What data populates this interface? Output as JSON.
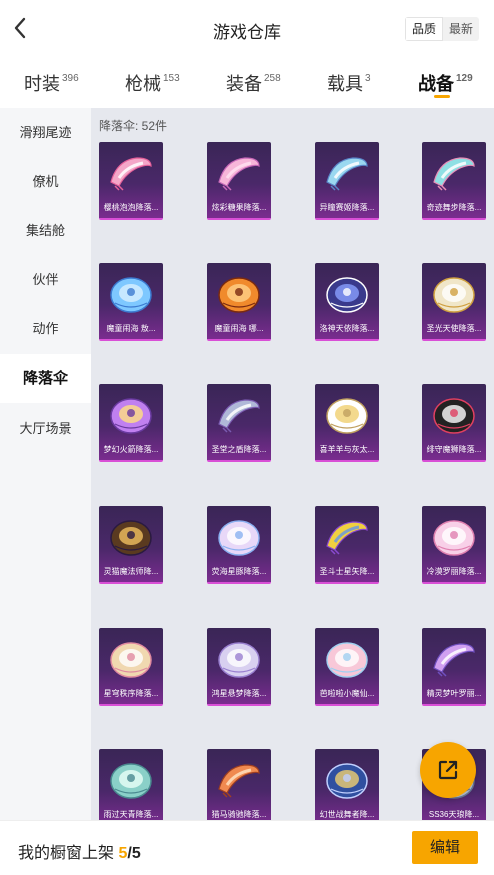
{
  "header": {
    "title": "游戏仓库",
    "sort_quality": "品质",
    "sort_newest": "最新"
  },
  "tabs": [
    {
      "label": "时装",
      "count": "396"
    },
    {
      "label": "枪械",
      "count": "153"
    },
    {
      "label": "装备",
      "count": "258"
    },
    {
      "label": "载具",
      "count": "3"
    },
    {
      "label": "战备",
      "count": "129",
      "active": true
    }
  ],
  "sidebar": {
    "items": [
      "滑翔尾迹",
      "僚机",
      "集结舱",
      "伙伴",
      "动作",
      "降落伞",
      "大厅场景"
    ],
    "active_index": 5
  },
  "content": {
    "count_label": "降落伞: 52件",
    "items": [
      {
        "label": "樱桃泡泡降落...",
        "icon": "pink-parachute"
      },
      {
        "label": "炫彩糖果降落...",
        "icon": "pink-parachute"
      },
      {
        "label": "异瞳赛姬降落...",
        "icon": "blue-parachute"
      },
      {
        "label": "奇迹舞步降落...",
        "icon": "teal-parachute"
      },
      {
        "label": "魔童闹海 敖...",
        "icon": "blue-round-parachute"
      },
      {
        "label": "魔童闹海 哪...",
        "icon": "fire-round-parachute"
      },
      {
        "label": "洛神天依降落...",
        "icon": "navy-round-parachute"
      },
      {
        "label": "圣光天使降落...",
        "icon": "white-gold-parachute"
      },
      {
        "label": "梦幻火箭降落...",
        "icon": "purple-parachute"
      },
      {
        "label": "圣堂之盾降落...",
        "icon": "silver-wing-parachute"
      },
      {
        "label": "喜羊羊与灰太...",
        "icon": "sheep-parachute"
      },
      {
        "label": "绯守魔狮降落...",
        "icon": "black-red-parachute"
      },
      {
        "label": "灵猫魔法师降...",
        "icon": "dark-gold-parachute"
      },
      {
        "label": "荧海星豚降落...",
        "icon": "pastel-parachute"
      },
      {
        "label": "圣斗士星矢降...",
        "icon": "gold-wing-parachute"
      },
      {
        "label": "冷漠罗丽降落...",
        "icon": "pink-white-parachute"
      },
      {
        "label": "星穹秩序降落...",
        "icon": "cream-parachute"
      },
      {
        "label": "鸿星悬梦降落...",
        "icon": "lilac-parachute"
      },
      {
        "label": "芭啦啦小魔仙...",
        "icon": "pink-fairy-parachute"
      },
      {
        "label": "精灵梦叶罗丽...",
        "icon": "purple-wing-parachute"
      },
      {
        "label": "雨过天青降落...",
        "icon": "teal-round-parachute"
      },
      {
        "label": "猎马骑驰降落...",
        "icon": "orange-wing-parachute"
      },
      {
        "label": "幻世战舞者降...",
        "icon": "blue-gold-parachute"
      },
      {
        "label": "SS36天琅降...",
        "icon": "silver-parachute"
      }
    ]
  },
  "bottom": {
    "showcase_label": "我的橱窗上架",
    "showcase_count": "5",
    "showcase_total": "/5",
    "edit_label": "编辑"
  },
  "colors": {
    "accent": "#f7a500",
    "card_bg": "#4a2869",
    "card_border": "#d94fd6"
  },
  "icons": {
    "back": "chevron-left-icon",
    "share": "share-external-icon"
  }
}
